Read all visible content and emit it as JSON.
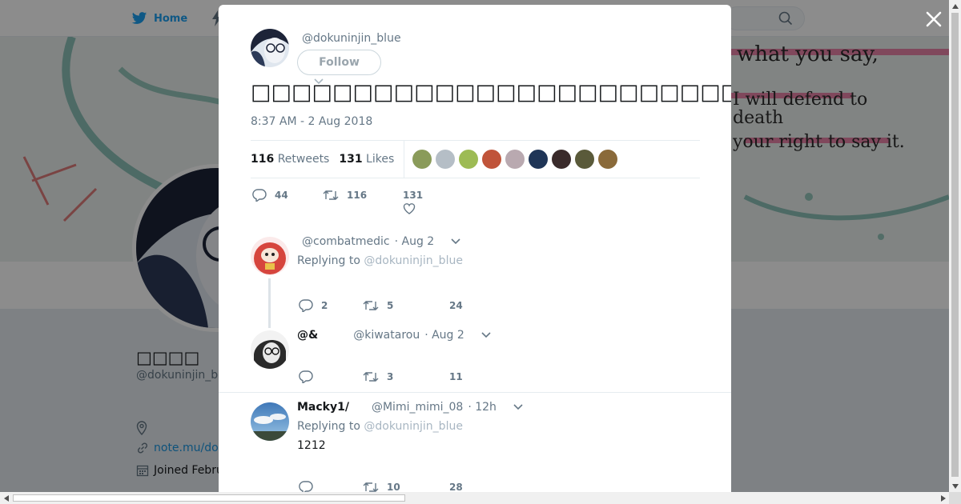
{
  "nav": {
    "home_label": "Home"
  },
  "profile": {
    "name": "□□□□",
    "handle": "@dokuninjin_b",
    "link": "note.mu/do",
    "joined": "Joined Febru",
    "banner_text": [
      "what you say,",
      "I will defend to",
      "death",
      "your right to say it."
    ]
  },
  "tweet": {
    "handle": "@dokuninjin_blue",
    "follow_label": "Follow",
    "text": "□□□□□□□□□□□□□□□□□□□□□□□□□□□□□□□□□□□□□□□□□□□□□□□□□",
    "time": "8:37 AM - 2 Aug 2018",
    "retweets_count": "116",
    "retweets_label": "Retweets",
    "likes_count": "131",
    "likes_label": "Likes",
    "liker_colors": [
      "#8a9b5a",
      "#b5bec6",
      "#9dbb54",
      "#c0543a",
      "#b9a9b0",
      "#1f3557",
      "#3a2b2b",
      "#5a5a3a",
      "#8a6a3a"
    ],
    "actions": {
      "replies": "44",
      "retweets": "116",
      "likes": "131"
    }
  },
  "replies": [
    {
      "name": "",
      "handle": "@combatmedic",
      "time": "· Aug 2",
      "replying_prefix": "Replying to",
      "replying_to": "@dokuninjin_blue",
      "body": "",
      "replies": "2",
      "retweets": "5",
      "likes": "24"
    },
    {
      "name": "@&",
      "handle": "@kiwatarou",
      "time": "· Aug 2",
      "replying_prefix": "",
      "replying_to": "",
      "body": "",
      "replies": "",
      "retweets": "3",
      "likes": "11"
    },
    {
      "name": "Macky1/",
      "handle": "@Mimi_mimi_08",
      "time": "· 12h",
      "replying_prefix": "Replying to",
      "replying_to": "@dokuninjin_blue",
      "body": "1212",
      "replies": "",
      "retweets": "10",
      "likes": "28"
    }
  ],
  "colors": {
    "accent": "#1da1f2",
    "muted": "#657786",
    "text": "#14171a"
  }
}
